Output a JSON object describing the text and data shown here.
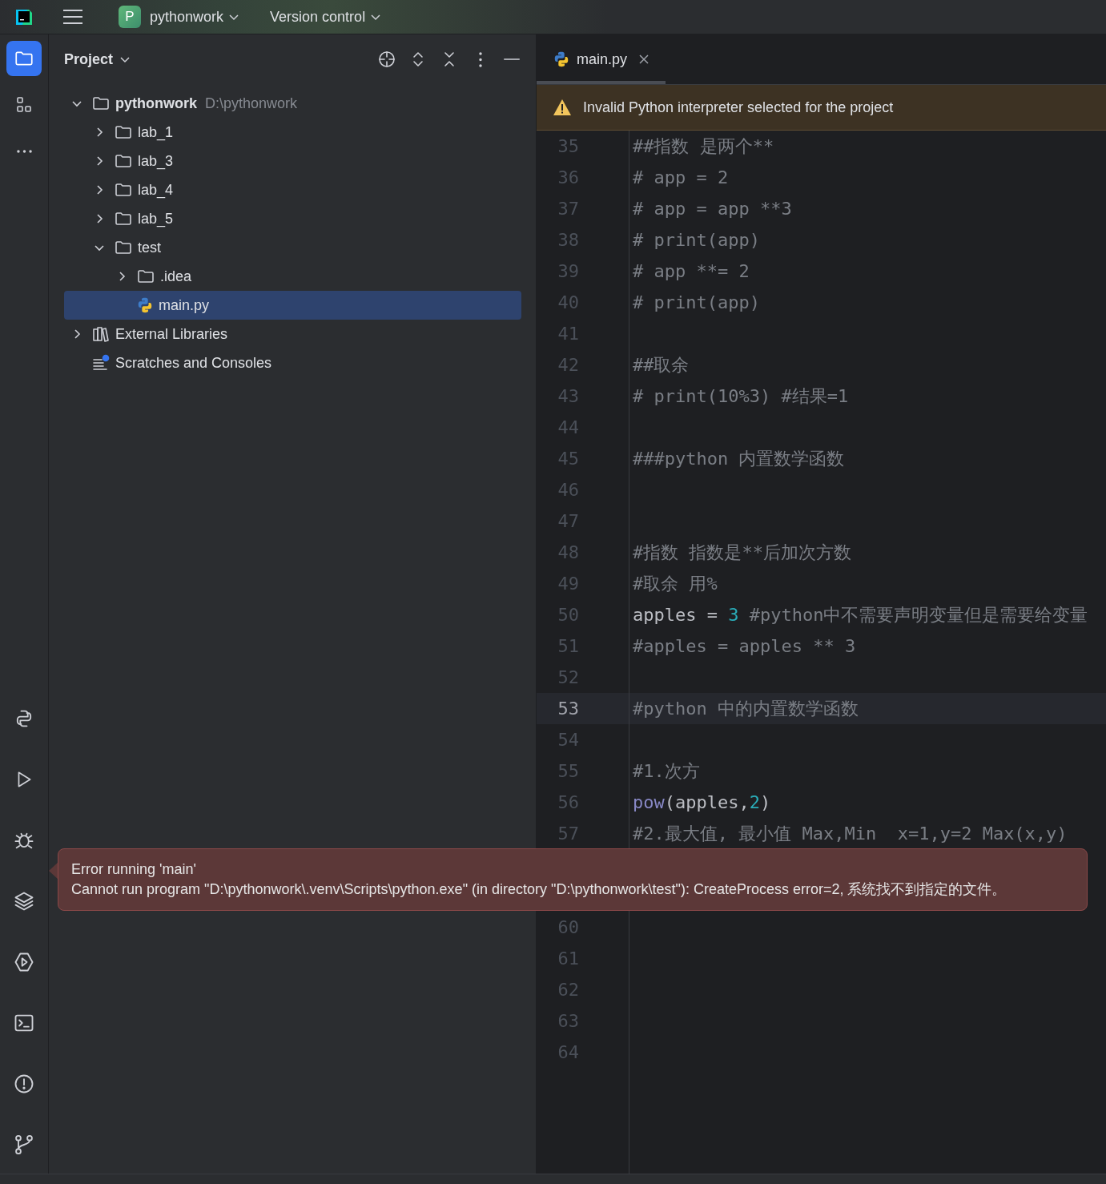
{
  "top_bar": {
    "project_badge": "P",
    "project_name": "pythonwork",
    "vcs_menu": "Version control"
  },
  "left_toolbar": {
    "top": [
      {
        "kind": "project",
        "selected": true
      },
      {
        "kind": "structure",
        "selected": false
      },
      {
        "kind": "more",
        "selected": false
      }
    ],
    "bottom": [
      {
        "kind": "python-console",
        "selected": false
      },
      {
        "kind": "run",
        "selected": false
      },
      {
        "kind": "debug",
        "selected": false
      },
      {
        "kind": "layers",
        "selected": false
      },
      {
        "kind": "services",
        "selected": false
      },
      {
        "kind": "terminal",
        "selected": false
      },
      {
        "kind": "problems",
        "selected": false
      },
      {
        "kind": "git",
        "selected": false
      }
    ]
  },
  "project_panel": {
    "title": "Project",
    "tree": [
      {
        "kind": "folder",
        "label": "pythonwork",
        "path": "D:\\pythonwork",
        "expanded": true,
        "selected": false,
        "children": [
          {
            "kind": "folder",
            "label": "lab_1",
            "expanded": false,
            "selected": false
          },
          {
            "kind": "folder",
            "label": "lab_3",
            "expanded": false,
            "selected": false
          },
          {
            "kind": "folder",
            "label": "lab_4",
            "expanded": false,
            "selected": false
          },
          {
            "kind": "folder",
            "label": "lab_5",
            "expanded": false,
            "selected": false
          },
          {
            "kind": "folder",
            "label": "test",
            "expanded": true,
            "selected": false,
            "children": [
              {
                "kind": "folder",
                "label": ".idea",
                "expanded": false,
                "selected": false
              },
              {
                "kind": "python",
                "label": "main.py",
                "selected": true
              }
            ]
          }
        ]
      },
      {
        "kind": "library",
        "label": "External Libraries",
        "expanded": false,
        "selected": false
      },
      {
        "kind": "scratches",
        "label": "Scratches and Consoles",
        "selected": false
      }
    ]
  },
  "editor": {
    "tabs": [
      {
        "label": "main.py",
        "selected": true
      }
    ],
    "warning": "Invalid Python interpreter selected for the project",
    "lines": [
      {
        "number": "35",
        "current": false,
        "tokens": [
          {
            "kind": "comment",
            "text": "##指数 是两个**"
          }
        ]
      },
      {
        "number": "36",
        "current": false,
        "tokens": [
          {
            "kind": "comment",
            "text": "# app = 2"
          }
        ]
      },
      {
        "number": "37",
        "current": false,
        "tokens": [
          {
            "kind": "comment",
            "text": "# app = app **3"
          }
        ]
      },
      {
        "number": "38",
        "current": false,
        "tokens": [
          {
            "kind": "comment",
            "text": "# print(app)"
          }
        ]
      },
      {
        "number": "39",
        "current": false,
        "tokens": [
          {
            "kind": "comment",
            "text": "# app **= 2"
          }
        ]
      },
      {
        "number": "40",
        "current": false,
        "tokens": [
          {
            "kind": "comment",
            "text": "# print(app)"
          }
        ]
      },
      {
        "number": "41",
        "current": false
      },
      {
        "number": "42",
        "current": false,
        "tokens": [
          {
            "kind": "comment",
            "text": "##取余"
          }
        ]
      },
      {
        "number": "43",
        "current": false,
        "tokens": [
          {
            "kind": "comment",
            "text": "# print(10%3) #结果=1"
          }
        ]
      },
      {
        "number": "44",
        "current": false
      },
      {
        "number": "45",
        "current": false,
        "tokens": [
          {
            "kind": "comment",
            "text": "###python 内置数学函数"
          }
        ]
      },
      {
        "number": "46",
        "current": false
      },
      {
        "number": "47",
        "current": false
      },
      {
        "number": "48",
        "current": false,
        "tokens": [
          {
            "kind": "comment",
            "text": "#指数 指数是**后加次方数"
          }
        ]
      },
      {
        "number": "49",
        "current": false,
        "tokens": [
          {
            "kind": "comment",
            "text": "#取余 用%"
          }
        ]
      },
      {
        "number": "50",
        "current": false,
        "tokens": [
          {
            "kind": "plain",
            "text": "apples = "
          },
          {
            "kind": "number",
            "text": "3"
          },
          {
            "kind": "comment",
            "text": " #python中不需要声明变量但是需要给变量"
          }
        ]
      },
      {
        "number": "51",
        "current": false,
        "tokens": [
          {
            "kind": "comment",
            "text": "#apples = apples ** 3"
          }
        ]
      },
      {
        "number": "52",
        "current": false
      },
      {
        "number": "53",
        "current": true,
        "tokens": [
          {
            "kind": "comment",
            "text": "#python 中的内置数学函数"
          }
        ]
      },
      {
        "number": "54",
        "current": false
      },
      {
        "number": "55",
        "current": false,
        "tokens": [
          {
            "kind": "comment",
            "text": "#1.次方"
          }
        ]
      },
      {
        "number": "56",
        "current": false,
        "tokens": [
          {
            "kind": "builtin",
            "text": "pow"
          },
          {
            "kind": "plain",
            "text": "(apples,"
          },
          {
            "kind": "number",
            "text": "2"
          },
          {
            "kind": "plain",
            "text": ")"
          }
        ]
      },
      {
        "number": "57",
        "current": false,
        "tokens": [
          {
            "kind": "comment",
            "text": "#2.最大值, 最小值 Max,Min  x=1,y=2 Max(x,y)"
          }
        ]
      },
      {
        "number": "60",
        "current": false
      },
      {
        "number": "61",
        "current": false
      },
      {
        "number": "62",
        "current": false
      },
      {
        "number": "63",
        "current": false
      },
      {
        "number": "64",
        "current": false
      }
    ]
  },
  "error_popup": {
    "title": "Error running 'main'",
    "message": "Cannot run program \"D:\\pythonwork\\.venv\\Scripts\\python.exe\" (in directory \"D:\\pythonwork\\test\"): CreateProcess error=2, 系统找不到指定的文件。"
  }
}
